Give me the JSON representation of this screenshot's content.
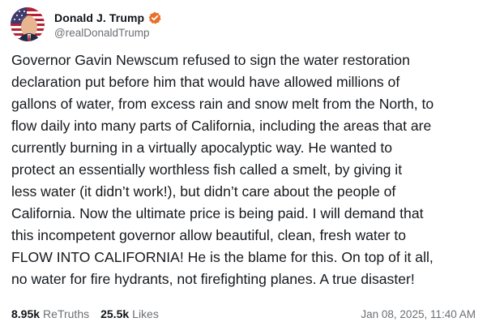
{
  "post": {
    "author": {
      "display_name": "Donald J. Trump",
      "handle": "@realDonaldTrump",
      "verified_icon": "verified-badge-icon",
      "verified_color": "#e8702a"
    },
    "body_lines": [
      "Governor Gavin Newscum refused to sign the water restoration",
      "declaration put before him that would have allowed millions of",
      "gallons of water, from excess rain and snow melt from the North, to",
      "flow daily into many parts of California, including the areas that are",
      "currently burning in a virtually apocalyptic way. He wanted to",
      "protect an essentially worthless fish  called a smelt, by giving it",
      "less water (it didn’t work!), but didn’t care about the people of",
      "California. Now the ultimate price is being paid. I will demand that",
      "this incompetent governor allow beautiful, clean, fresh water to",
      "FLOW INTO CALIFORNIA! He is the blame for this. On top of it all,",
      "no water for fire hydrants, not firefighting planes. A true disaster!"
    ],
    "stats": {
      "retruths_count": "8.95k",
      "retruths_label": "ReTruths",
      "likes_count": "25.5k",
      "likes_label": "Likes"
    },
    "timestamp": "Jan 08, 2025, 11:40 AM"
  }
}
